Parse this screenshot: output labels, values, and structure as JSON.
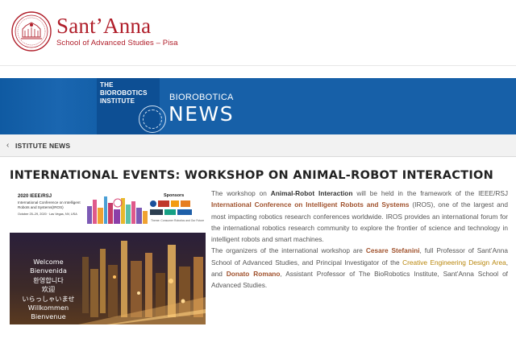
{
  "header": {
    "brand_name": "Sant’Anna",
    "brand_sub": "School of Advanced Studies – Pisa"
  },
  "banner": {
    "institute_title": "THE BIOROBOTICS INSTITUTE",
    "kicker": "BIOROBOTICA",
    "title": "NEWS"
  },
  "breadcrumb": {
    "link": "ISTITUTE NEWS"
  },
  "article": {
    "title": "INTERNATIONAL EVENTS: WORKSHOP ON ANIMAL-ROBOT INTERACTION",
    "event_banner": {
      "year": "2020 IEEE/RSJ",
      "name": "International Conference on Intelligent Robots and Systems(IROS)",
      "date": "October 25–29, 2020 · Las Vegas, NV, USA",
      "sponsors": "Sponsors",
      "theme": "Theme: Consumer Robotics and Our Future"
    },
    "welcome_lines": [
      "Welcome",
      "Bienvenida",
      "환영합니다",
      "欢迎",
      "いらっしゃいませ",
      "Willkommen",
      "Bienvenue"
    ],
    "p1": {
      "t1": "The workshop on ",
      "b1": "Animal-Robot Interaction",
      "t2": " will be held in the framework of the IEEE/RSJ ",
      "b2": "International Conference on Intelligent Robots and Systems",
      "t3": " (IROS), one of the largest and most impacting robotics research conferences worldwide. IROS provides an international forum for the international robotics research community to explore the frontier of science and technology in intelligent robots and smart machines."
    },
    "p2": {
      "t1": "The organizers of the international workshop are ",
      "b1": "Cesare Stefanini",
      "t2": ", full Professor of Sant’Anna School of Advanced Studies, and Principal Investigator of the ",
      "l1": "Creative Engineering Design Area",
      "t3": ", and ",
      "b2": "Donato Romano",
      "t4": ", Assistant Professor of The BioRobotics Institute, Sant’Anna School of Advanced Studies."
    }
  },
  "colors": {
    "brand_red": "#b01e2a",
    "banner_blue": "#1760a8",
    "highlight": "#a0522d"
  }
}
